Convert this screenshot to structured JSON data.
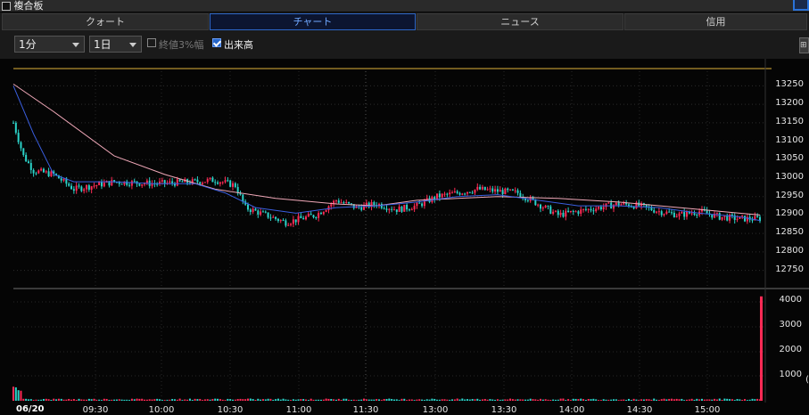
{
  "window": {
    "title": "複合板"
  },
  "tabs": [
    "クォート",
    "チャート",
    "ニュース",
    "信用"
  ],
  "toolbar": {
    "interval": "1分",
    "range": "1日",
    "opt1": "終値3%幅",
    "opt2": "出来高",
    "side_btn": "⊞"
  },
  "colors": {
    "up": "#ff2a55",
    "down": "#2bd3c9",
    "ma_short": "#3a5fe0",
    "ma_long": "#f0a8b8",
    "ref_line": "#e0b23a",
    "volume": "#ff2a55"
  },
  "price_axis": {
    "ticks": [
      "13250",
      "13200",
      "13150",
      "13100",
      "13050",
      "13000",
      "12950",
      "12900",
      "12850",
      "12800",
      "12750"
    ]
  },
  "volume_axis": {
    "ticks": [
      "4000",
      "3000",
      "2000",
      "1000"
    ],
    "extra": "("
  },
  "time_axis": {
    "date": "06/20",
    "ticks": [
      "09:30",
      "10:00",
      "10:30",
      "11:00",
      "11:30",
      "13:00",
      "13:30",
      "14:00",
      "14:30",
      "15:00"
    ]
  },
  "chart_data": {
    "type": "candlestick",
    "price_range": [
      12720,
      13280
    ],
    "reference_price": 13270,
    "close_path": [
      [
        0,
        13150
      ],
      [
        1,
        13060
      ],
      [
        2,
        13020
      ],
      [
        4,
        13010
      ],
      [
        6,
        12970
      ],
      [
        8,
        12980
      ],
      [
        10,
        12990
      ],
      [
        14,
        12985
      ],
      [
        18,
        12990
      ],
      [
        20,
        12995
      ],
      [
        22,
        12980
      ],
      [
        23,
        12920
      ],
      [
        25,
        12900
      ],
      [
        27,
        12880
      ],
      [
        30,
        12900
      ],
      [
        32,
        12940
      ],
      [
        34,
        12920
      ],
      [
        36,
        12930
      ],
      [
        38,
        12915
      ],
      [
        40,
        12925
      ],
      [
        42,
        12950
      ],
      [
        44,
        12960
      ],
      [
        46,
        12970
      ],
      [
        48,
        12965
      ],
      [
        50,
        12960
      ],
      [
        52,
        12930
      ],
      [
        54,
        12900
      ],
      [
        56,
        12910
      ],
      [
        58,
        12920
      ],
      [
        60,
        12930
      ],
      [
        62,
        12925
      ],
      [
        64,
        12910
      ],
      [
        66,
        12900
      ],
      [
        68,
        12910
      ],
      [
        70,
        12895
      ],
      [
        72,
        12890
      ],
      [
        74,
        12890
      ]
    ],
    "ma_short": [
      [
        0,
        13250
      ],
      [
        2,
        13120
      ],
      [
        4,
        13010
      ],
      [
        6,
        12990
      ],
      [
        10,
        12990
      ],
      [
        14,
        12985
      ],
      [
        18,
        12985
      ],
      [
        21,
        12960
      ],
      [
        24,
        12920
      ],
      [
        28,
        12905
      ],
      [
        32,
        12920
      ],
      [
        36,
        12925
      ],
      [
        40,
        12935
      ],
      [
        44,
        12950
      ],
      [
        48,
        12955
      ],
      [
        52,
        12940
      ],
      [
        56,
        12925
      ],
      [
        60,
        12925
      ],
      [
        64,
        12920
      ],
      [
        68,
        12905
      ],
      [
        72,
        12895
      ],
      [
        74,
        12885
      ]
    ],
    "ma_long": [
      [
        0,
        13255
      ],
      [
        4,
        13180
      ],
      [
        10,
        13060
      ],
      [
        15,
        13010
      ],
      [
        20,
        12970
      ],
      [
        26,
        12945
      ],
      [
        32,
        12930
      ],
      [
        36,
        12925
      ],
      [
        40,
        12940
      ],
      [
        44,
        12945
      ],
      [
        48,
        12950
      ],
      [
        54,
        12945
      ],
      [
        60,
        12935
      ],
      [
        66,
        12920
      ],
      [
        72,
        12905
      ],
      [
        74,
        12900
      ]
    ],
    "volume_spike": 4200,
    "volume_max": 4300
  }
}
